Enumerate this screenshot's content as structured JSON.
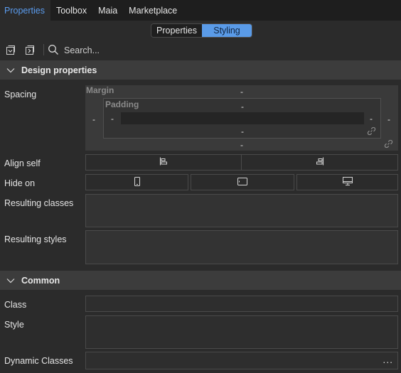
{
  "tabs": [
    {
      "label": "Properties",
      "active": true
    },
    {
      "label": "Toolbox",
      "active": false
    },
    {
      "label": "Maia",
      "active": false
    },
    {
      "label": "Marketplace",
      "active": false
    }
  ],
  "view_toggle": {
    "properties": "Properties",
    "styling": "Styling",
    "selected": "Styling"
  },
  "toolbar": {
    "search_placeholder": "Search...",
    "icons": [
      "collapse-all-icon",
      "expand-all-icon",
      "search-icon"
    ]
  },
  "design_section": {
    "title": "Design properties",
    "spacing_label": "Spacing",
    "margin_label": "Margin",
    "padding_label": "Padding",
    "margin": {
      "top": "-",
      "right": "-",
      "bottom": "-",
      "left": "-"
    },
    "padding": {
      "top": "-",
      "right": "-",
      "bottom": "-",
      "left": "-"
    },
    "align_self_label": "Align self",
    "hide_on_label": "Hide on",
    "resulting_classes_label": "Resulting classes",
    "resulting_styles_label": "Resulting styles"
  },
  "common_section": {
    "title": "Common",
    "class_label": "Class",
    "style_label": "Style",
    "dynamic_classes_label": "Dynamic Classes",
    "more_label": "..."
  },
  "colors": {
    "accent": "#5b9df0",
    "toggle_selected": "#5a9be8",
    "panel": "#2b2b2b",
    "header": "#3c3c3c"
  }
}
